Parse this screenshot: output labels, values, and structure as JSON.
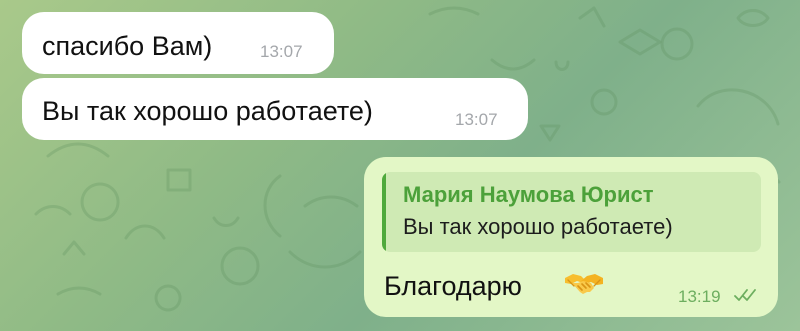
{
  "chat": {
    "messages": [
      {
        "direction": "incoming",
        "text": "спасибо Вам)",
        "time": "13:07"
      },
      {
        "direction": "incoming",
        "text": "Вы так хорошо работаете)",
        "time": "13:07"
      },
      {
        "direction": "outgoing",
        "reply": {
          "author": "Мария Наумова Юрист",
          "text": "Вы так хорошо работаете)"
        },
        "text": "Благодарю",
        "emoji": "handshake-emoji",
        "time": "13:19",
        "status_icon": "double-check-icon",
        "status": "read"
      }
    ]
  },
  "theme": {
    "incoming_bubble": "#ffffff",
    "outgoing_bubble": "#e3f7c6",
    "reply_accent": "#4ca13a",
    "timestamp_incoming": "#a4a7ab",
    "timestamp_outgoing": "#6dae5f",
    "wallpaper": "#8fba86"
  }
}
